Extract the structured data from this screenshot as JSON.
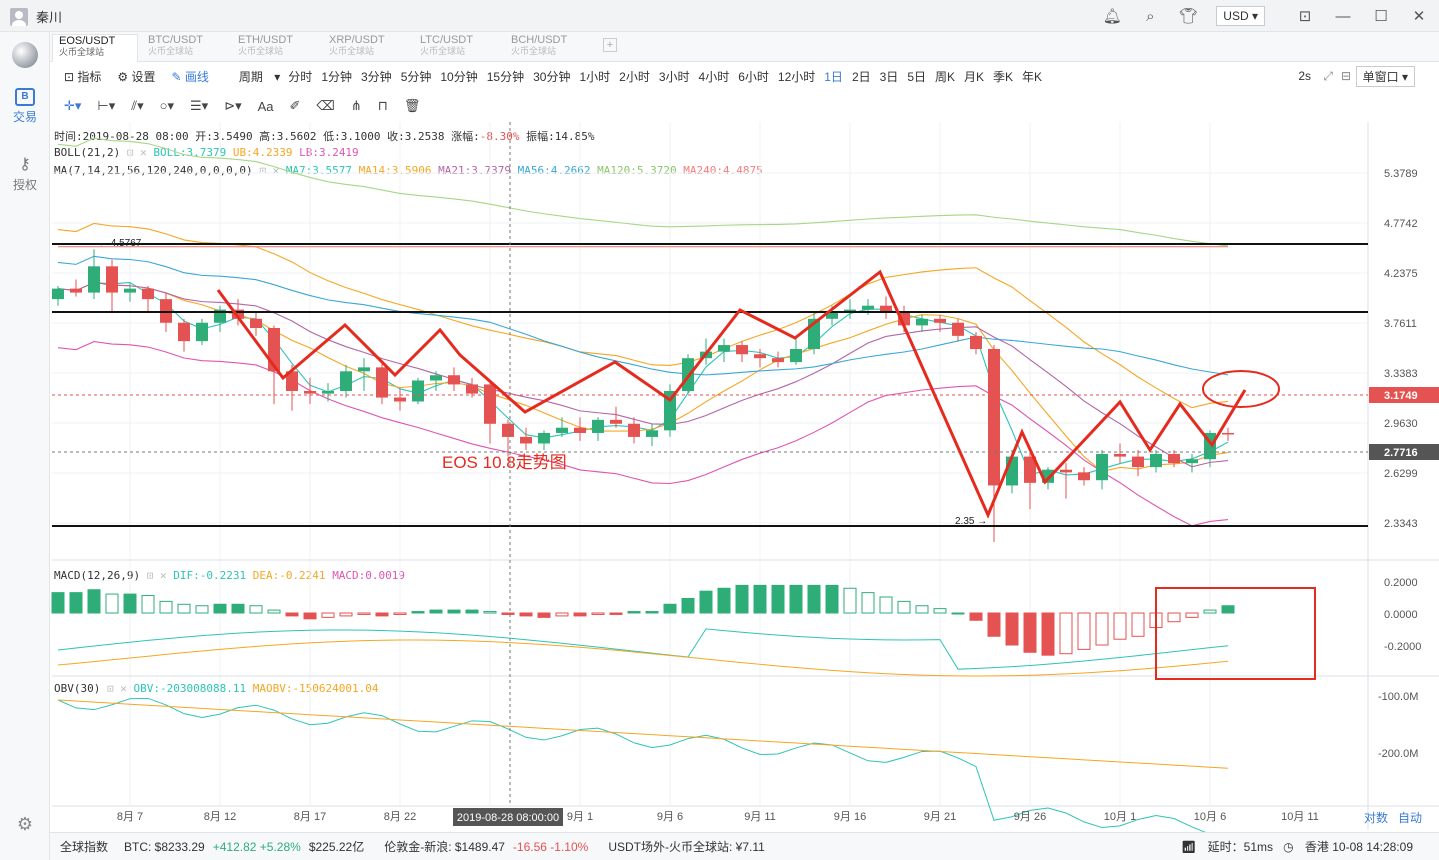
{
  "window": {
    "user": "秦川",
    "currency": "USD ▾"
  },
  "sidebar": {
    "items": [
      "交易",
      "授权"
    ]
  },
  "pairs": [
    {
      "name": "EOS/USDT",
      "sub": "火币全球站"
    },
    {
      "name": "BTC/USDT",
      "sub": "火币全球站"
    },
    {
      "name": "ETH/USDT",
      "sub": "火币全球站"
    },
    {
      "name": "XRP/USDT",
      "sub": "火币全球站"
    },
    {
      "name": "LTC/USDT",
      "sub": "火币全球站"
    },
    {
      "name": "BCH/USDT",
      "sub": "火币全球站"
    }
  ],
  "toolbar": {
    "indicator": "指标",
    "settings": "设置",
    "draw": "画线",
    "period": "周期",
    "periods": [
      "分时",
      "1分钟",
      "3分钟",
      "5分钟",
      "10分钟",
      "15分钟",
      "30分钟",
      "1小时",
      "2小时",
      "3小时",
      "4小时",
      "6小时",
      "12小时",
      "1日",
      "2日",
      "3日",
      "5日",
      "周K",
      "月K",
      "季K",
      "年K"
    ],
    "active_period": "1日",
    "refresh": "2s",
    "window_mode": "单窗口 ▾"
  },
  "info": {
    "line1": "时间:2019-08-28 08:00  开:3.5490  高:3.5602  低:3.1000  收:3.2538  涨幅:",
    "change": "-8.30%",
    "amp": "  振幅:14.85%",
    "boll_name": "BOLL(21,2)",
    "boll": "BOLL:3.7379",
    "ub": "UB:4.2339",
    "lb": "LB:3.2419",
    "ma_name": "MA(7,14,21,56,120,240,0,0,0,0)",
    "ma7": "MA7:3.5577",
    "ma14": "MA14:3.5906",
    "ma21": "MA21:3.7379",
    "ma56": "MA56:4.2662",
    "ma120": "MA120:5.3720",
    "ma240": "MA240:4.4875",
    "macd_name": "MACD(12,26,9)",
    "dif": "DIF:-0.2231",
    "dea": "DEA:-0.2241",
    "macd": "MACD:0.0019",
    "obv_name": "OBV(30)",
    "obv": "OBV:-203008088.11",
    "maobv": "MAOBV:-150624001.04"
  },
  "annotations": {
    "title": "EOS 10.8走势图",
    "high": "← 4.5767",
    "low": "2.35 →"
  },
  "price_axis": [
    "5.3789",
    "4.7742",
    "4.2375",
    "3.7611",
    "3.3383",
    "2.9630",
    "2.6299",
    "2.3343"
  ],
  "price_tags": {
    "current": "3.1749",
    "cursor": "2.7716"
  },
  "macd_axis": [
    "0.2000",
    "0.0000",
    "-0.2000"
  ],
  "obv_axis": [
    "-100.0M",
    "-200.0M"
  ],
  "date_axis": [
    "8月 7",
    "8月 12",
    "8月 17",
    "8月 22",
    "9月 1",
    "9月 6",
    "9月 11",
    "9月 16",
    "9月 21",
    "9月 26",
    "10月 1",
    "10月 6",
    "10月 11"
  ],
  "cursor_date": "2019-08-28 08:00:00",
  "axis_buttons": {
    "log": "对数",
    "auto": "自动"
  },
  "status": {
    "index": "全球指数",
    "btc": "BTC: $8233.29",
    "btc_chg": "+412.82 +5.28%",
    "btc_vol": "$225.22亿",
    "ldn": "伦敦金-新浪: $1489.47",
    "ldn_chg": "-16.56 -1.10%",
    "usdt": "USDT场外-火币全球站: ¥7.11",
    "latency": "延时：51ms",
    "server": "香港 10-08 14:28:09"
  },
  "colors": {
    "up": "#2ead78",
    "down": "#e55252",
    "ma7": "#2ec4b6",
    "ma14": "#f5a623",
    "ma21": "#9b59b6",
    "ma56": "#3aa7d8",
    "ma120": "#a6d785",
    "ma240": "#f08080"
  },
  "chart_data": {
    "type": "candlestick",
    "dates": [
      "8-4",
      "8-5",
      "8-6",
      "8-7",
      "8-8",
      "8-9",
      "8-10",
      "8-11",
      "8-12",
      "8-13",
      "8-14",
      "8-15",
      "8-16",
      "8-17",
      "8-18",
      "8-19",
      "8-20",
      "8-21",
      "8-22",
      "8-23",
      "8-24",
      "8-25",
      "8-26",
      "8-27",
      "8-28",
      "8-29",
      "8-30",
      "8-31",
      "9-1",
      "9-2",
      "9-3",
      "9-4",
      "9-5",
      "9-6",
      "9-7",
      "9-8",
      "9-9",
      "9-10",
      "9-11",
      "9-12",
      "9-13",
      "9-14",
      "9-15",
      "9-16",
      "9-17",
      "9-18",
      "9-19",
      "9-20",
      "9-21",
      "9-22",
      "9-23",
      "9-24",
      "9-25",
      "9-26",
      "9-27",
      "9-28",
      "9-29",
      "9-30",
      "10-1",
      "10-2",
      "10-3",
      "10-4",
      "10-5",
      "10-6",
      "10-7",
      "10-8"
    ],
    "ohlc": [
      [
        4.2,
        4.3,
        4.15,
        4.28
      ],
      [
        4.28,
        4.35,
        4.22,
        4.25
      ],
      [
        4.25,
        4.58,
        4.2,
        4.45
      ],
      [
        4.45,
        4.5,
        4.1,
        4.25
      ],
      [
        4.25,
        4.32,
        4.18,
        4.28
      ],
      [
        4.28,
        4.3,
        4.1,
        4.2
      ],
      [
        4.2,
        4.25,
        3.95,
        4.02
      ],
      [
        4.02,
        4.05,
        3.8,
        3.88
      ],
      [
        3.88,
        4.05,
        3.85,
        4.02
      ],
      [
        4.02,
        4.15,
        3.95,
        4.12
      ],
      [
        4.12,
        4.2,
        4.0,
        4.05
      ],
      [
        4.05,
        4.1,
        3.92,
        3.98
      ],
      [
        3.98,
        4.0,
        3.4,
        3.65
      ],
      [
        3.65,
        3.7,
        3.35,
        3.5
      ],
      [
        3.5,
        3.6,
        3.4,
        3.48
      ],
      [
        3.48,
        3.56,
        3.42,
        3.5
      ],
      [
        3.5,
        3.7,
        3.45,
        3.65
      ],
      [
        3.65,
        3.75,
        3.5,
        3.68
      ],
      [
        3.68,
        3.72,
        3.4,
        3.45
      ],
      [
        3.45,
        3.52,
        3.35,
        3.42
      ],
      [
        3.42,
        3.6,
        3.4,
        3.58
      ],
      [
        3.58,
        3.65,
        3.5,
        3.62
      ],
      [
        3.62,
        3.68,
        3.5,
        3.55
      ],
      [
        3.55,
        3.6,
        3.45,
        3.48
      ],
      [
        3.55,
        3.56,
        3.1,
        3.25
      ],
      [
        3.25,
        3.28,
        3.0,
        3.15
      ],
      [
        3.15,
        3.22,
        3.05,
        3.1
      ],
      [
        3.1,
        3.2,
        3.05,
        3.18
      ],
      [
        3.18,
        3.3,
        3.15,
        3.22
      ],
      [
        3.22,
        3.3,
        3.12,
        3.18
      ],
      [
        3.18,
        3.3,
        3.12,
        3.28
      ],
      [
        3.28,
        3.38,
        3.22,
        3.25
      ],
      [
        3.25,
        3.3,
        3.1,
        3.15
      ],
      [
        3.15,
        3.25,
        3.08,
        3.2
      ],
      [
        3.2,
        3.55,
        3.15,
        3.5
      ],
      [
        3.5,
        3.78,
        3.48,
        3.75
      ],
      [
        3.75,
        3.9,
        3.7,
        3.8
      ],
      [
        3.8,
        3.9,
        3.72,
        3.85
      ],
      [
        3.85,
        3.88,
        3.72,
        3.78
      ],
      [
        3.78,
        3.82,
        3.68,
        3.75
      ],
      [
        3.75,
        3.8,
        3.68,
        3.72
      ],
      [
        3.72,
        3.9,
        3.7,
        3.82
      ],
      [
        3.82,
        4.1,
        3.78,
        4.05
      ],
      [
        4.05,
        4.15,
        4.0,
        4.1
      ],
      [
        4.1,
        4.2,
        4.05,
        4.12
      ],
      [
        4.12,
        4.2,
        4.08,
        4.15
      ],
      [
        4.15,
        4.22,
        4.05,
        4.1
      ],
      [
        4.1,
        4.15,
        3.95,
        4.0
      ],
      [
        4.0,
        4.08,
        3.95,
        4.05
      ],
      [
        4.05,
        4.08,
        3.95,
        4.02
      ],
      [
        4.02,
        4.05,
        3.88,
        3.92
      ],
      [
        3.92,
        3.95,
        3.78,
        3.82
      ],
      [
        3.82,
        3.85,
        2.35,
        2.78
      ],
      [
        2.78,
        3.05,
        2.72,
        3.0
      ],
      [
        3.0,
        3.05,
        2.6,
        2.8
      ],
      [
        2.8,
        2.92,
        2.75,
        2.9
      ],
      [
        2.9,
        2.95,
        2.68,
        2.88
      ],
      [
        2.88,
        2.92,
        2.78,
        2.82
      ],
      [
        2.82,
        3.05,
        2.75,
        3.02
      ],
      [
        3.02,
        3.1,
        2.95,
        3.0
      ],
      [
        3.0,
        3.05,
        2.85,
        2.92
      ],
      [
        2.92,
        3.05,
        2.88,
        3.02
      ],
      [
        3.02,
        3.05,
        2.92,
        2.95
      ],
      [
        2.95,
        3.02,
        2.88,
        2.98
      ],
      [
        2.98,
        3.2,
        2.92,
        3.18
      ],
      [
        3.18,
        3.22,
        3.12,
        3.17
      ]
    ],
    "price_range": [
      2.25,
      5.55
    ],
    "macd": {
      "bars": [
        0.14,
        0.14,
        0.16,
        0.13,
        0.13,
        0.12,
        0.08,
        0.06,
        0.05,
        0.06,
        0.06,
        0.05,
        0.02,
        -0.02,
        -0.04,
        -0.03,
        -0.02,
        -0.01,
        -0.02,
        -0.01,
        0.01,
        0.02,
        0.02,
        0.02,
        0.01,
        -0.01,
        -0.02,
        -0.03,
        -0.02,
        -0.02,
        -0.01,
        -0.01,
        0.01,
        0.01,
        0.06,
        0.1,
        0.15,
        0.17,
        0.19,
        0.19,
        0.19,
        0.19,
        0.19,
        0.19,
        0.17,
        0.14,
        0.11,
        0.08,
        0.05,
        0.03,
        0.0,
        -0.05,
        -0.16,
        -0.22,
        -0.27,
        -0.29,
        -0.28,
        -0.25,
        -0.22,
        -0.18,
        -0.16,
        -0.1,
        -0.06,
        -0.03,
        0.02,
        0.05
      ],
      "range": [
        -0.32,
        0.22
      ]
    }
  }
}
